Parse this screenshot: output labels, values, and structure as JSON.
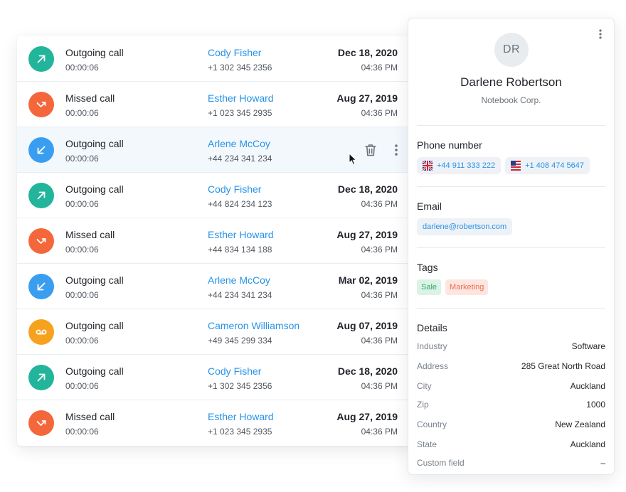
{
  "calls": [
    {
      "type": "Outgoing call",
      "duration": "00:00:06",
      "name": "Cody Fisher",
      "phone": "+1 302 345 2356",
      "date": "Dec 18, 2020",
      "time": "04:36 PM",
      "icon": "outgoing-arrow-icon",
      "color": "#22b59b"
    },
    {
      "type": "Missed call",
      "duration": "00:00:06",
      "name": "Esther Howard",
      "phone": "+1 023 345 2935",
      "date": "Aug 27, 2019",
      "time": "04:36 PM",
      "icon": "missed-call-icon",
      "color": "#f4673b"
    },
    {
      "type": "Outgoing call",
      "duration": "00:00:06",
      "name": "Arlene McCoy",
      "phone": "+44 234 341 234",
      "date": "",
      "time": "",
      "icon": "incoming-arrow-icon",
      "color": "#3a9ef0"
    },
    {
      "type": "Outgoing call",
      "duration": "00:00:06",
      "name": "Cody Fisher",
      "phone": "+44 824 234 123",
      "date": "Dec 18, 2020",
      "time": "04:36 PM",
      "icon": "outgoing-arrow-icon",
      "color": "#22b59b"
    },
    {
      "type": "Missed call",
      "duration": "00:00:06",
      "name": "Esther Howard",
      "phone": "+44 834 134 188",
      "date": "Aug 27, 2019",
      "time": "04:36 PM",
      "icon": "missed-call-icon",
      "color": "#f4673b"
    },
    {
      "type": "Outgoing call",
      "duration": "00:00:06",
      "name": "Arlene McCoy",
      "phone": "+44 234 341 234",
      "date": "Mar 02, 2019",
      "time": "04:36 PM",
      "icon": "incoming-arrow-icon",
      "color": "#3a9ef0"
    },
    {
      "type": "Outgoing call",
      "duration": "00:00:06",
      "name": "Cameron Williamson",
      "phone": "+49 345 299 334",
      "date": "Aug 07, 2019",
      "time": "04:36 PM",
      "icon": "voicemail-icon",
      "color": "#f7a21e"
    },
    {
      "type": "Outgoing call",
      "duration": "00:00:06",
      "name": "Cody Fisher",
      "phone": "+1 302 345 2356",
      "date": "Dec 18, 2020",
      "time": "04:36 PM",
      "icon": "outgoing-arrow-icon",
      "color": "#22b59b"
    },
    {
      "type": "Missed call",
      "duration": "00:00:06",
      "name": "Esther Howard",
      "phone": "+1 023 345 2935",
      "date": "Aug 27, 2019",
      "time": "04:36 PM",
      "icon": "missed-call-icon",
      "color": "#f4673b"
    }
  ],
  "row_actions": {
    "delete_icon": "trash-icon",
    "menu_icon": "more-vertical-icon"
  },
  "contact": {
    "initials": "DR",
    "name": "Darlene Robertson",
    "company": "Notebook Corp.",
    "phone_section": "Phone number",
    "phones": [
      {
        "flag": "uk-flag-icon",
        "number": "+44 911 333 222"
      },
      {
        "flag": "us-flag-icon",
        "number": "+1 408 474 5647"
      }
    ],
    "email_section": "Email",
    "email": "darlene@robertson.com",
    "tags_section": "Tags",
    "tags": [
      "Sale",
      "Marketing"
    ],
    "details_section": "Details",
    "details": [
      {
        "label": "Industry",
        "value": "Software"
      },
      {
        "label": "Address",
        "value": "285 Great North Road"
      },
      {
        "label": "City",
        "value": "Auckland"
      },
      {
        "label": "Zip",
        "value": "1000"
      },
      {
        "label": "Country",
        "value": "New Zealand"
      },
      {
        "label": "State",
        "value": "Auckland"
      },
      {
        "label": "Custom field",
        "value": "–"
      }
    ]
  },
  "colors": {
    "link": "#2793e8",
    "green": "#22b59b",
    "red": "#f4673b",
    "blue": "#3a9ef0",
    "orange": "#f7a21e"
  }
}
